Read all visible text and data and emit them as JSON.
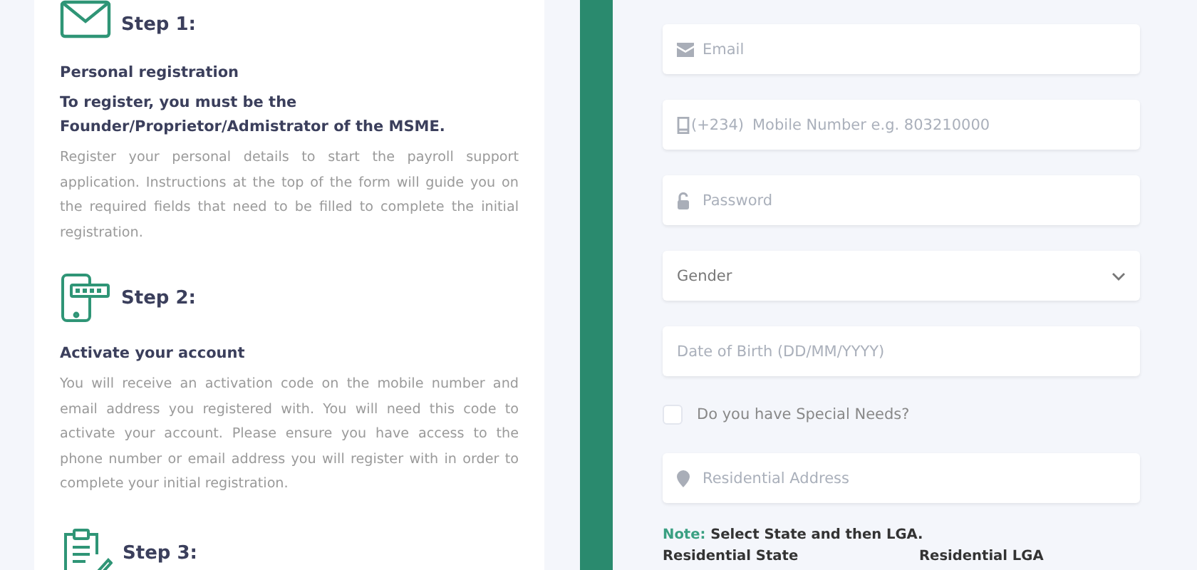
{
  "steps": [
    {
      "title": "Step 1:",
      "heading": "Personal registration",
      "subheading": "To register, you must be the Founder/Proprietor/Admistrator of the MSME.",
      "body": "Register your personal details to start the payroll support application. Instructions at the top of the form will guide you on the required fields that need to be filled to complete the initial registration."
    },
    {
      "title": "Step 2:",
      "heading": "Activate your account",
      "body": "You will receive an activation code on the mobile number and email address you registered with. You will need this code to activate your account. Please ensure you have access to the phone number or email address you will register with in order to complete your initial registration."
    },
    {
      "title": "Step 3:"
    }
  ],
  "form": {
    "fields": [
      {
        "kind": "input",
        "placeholder": "Email"
      },
      {
        "kind": "input",
        "prefix": "(+234)",
        "placeholder": "Mobile Number e.g. 803210000"
      },
      {
        "kind": "input",
        "placeholder": "Password"
      },
      {
        "kind": "select",
        "value": "Gender"
      },
      {
        "kind": "input",
        "placeholder": "Date of Birth (DD/MM/YYYY)"
      },
      {
        "kind": "checkbox",
        "label": "Do you have Special Needs?",
        "checked": false
      },
      {
        "kind": "input",
        "placeholder": "Residential Address"
      }
    ],
    "note": {
      "label": "Note:",
      "text": "Select State and then LGA."
    },
    "location_labels": [
      "Residential State",
      "Residential LGA"
    ]
  }
}
